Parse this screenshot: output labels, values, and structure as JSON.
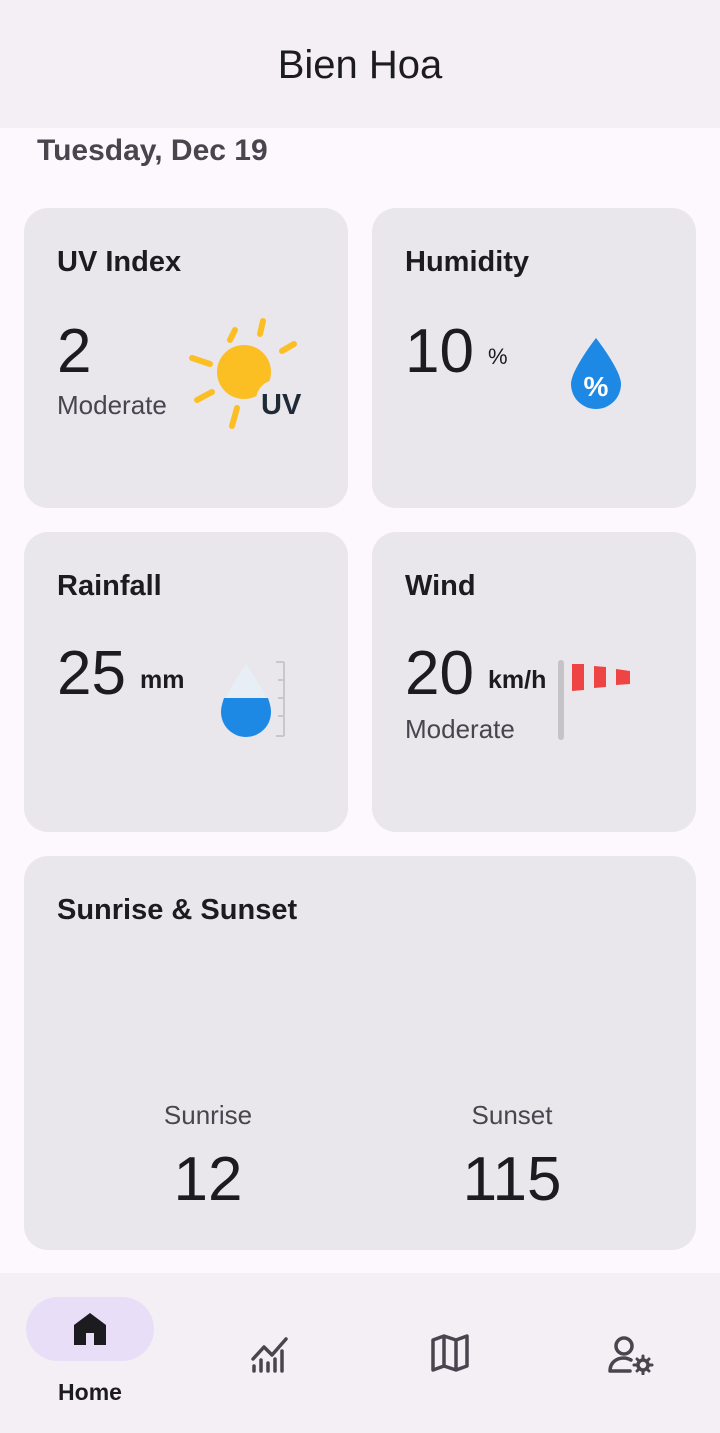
{
  "header": {
    "city": "Bien Hoa"
  },
  "date": "Tuesday, Dec 19",
  "uv": {
    "label": "UV Index",
    "value": "2",
    "level": "Moderate",
    "icon": "uv-sun-icon",
    "icon_text": "UV"
  },
  "humidity": {
    "label": "Humidity",
    "value": "10",
    "unit": "%",
    "icon": "humidity-drop-icon",
    "icon_text": "%"
  },
  "rainfall": {
    "label": "Rainfall",
    "value": "25",
    "unit": "mm",
    "icon": "rain-gauge-icon"
  },
  "wind": {
    "label": "Wind",
    "value": "20",
    "unit": "km/h",
    "level": "Moderate",
    "icon": "windsock-icon"
  },
  "sun": {
    "label": "Sunrise & Sunset",
    "sunrise_label": "Sunrise",
    "sunrise_value": "12",
    "sunset_label": "Sunset",
    "sunset_value": "115"
  },
  "nav": {
    "items": [
      {
        "label": "Home",
        "icon": "home-icon",
        "active": true
      },
      {
        "label": "",
        "icon": "chart-icon",
        "active": false
      },
      {
        "label": "",
        "icon": "map-icon",
        "active": false
      },
      {
        "label": "",
        "icon": "user-settings-icon",
        "active": false
      }
    ]
  },
  "colors": {
    "background": "#fdf8fd",
    "card": "#e9e6ec",
    "active_pill": "#e8def8",
    "sun_yellow": "#fbbf24",
    "drop_blue": "#1e88e5",
    "windsock_red": "#ef4444"
  }
}
